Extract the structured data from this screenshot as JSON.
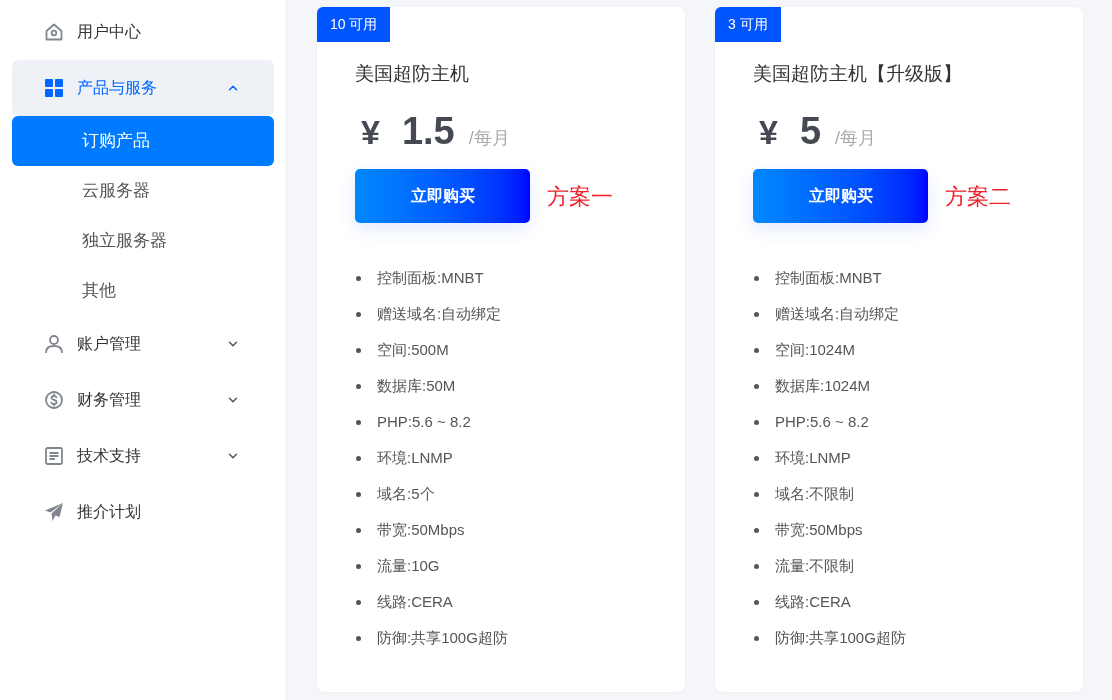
{
  "sidebar": {
    "items": [
      {
        "label": "用户中心",
        "kind": "link",
        "selected": false
      },
      {
        "label": "产品与服务",
        "kind": "group",
        "selected": true,
        "expanded": true,
        "children": [
          {
            "label": "订购产品",
            "selected": true
          },
          {
            "label": "云服务器",
            "selected": false
          },
          {
            "label": "独立服务器",
            "selected": false
          },
          {
            "label": "其他",
            "selected": false
          }
        ]
      },
      {
        "label": "账户管理",
        "kind": "group",
        "selected": false,
        "expanded": false
      },
      {
        "label": "财务管理",
        "kind": "group",
        "selected": false,
        "expanded": false
      },
      {
        "label": "技术支持",
        "kind": "group",
        "selected": false,
        "expanded": false
      },
      {
        "label": "推介计划",
        "kind": "link",
        "selected": false
      }
    ]
  },
  "plans": [
    {
      "badge": "10 可用",
      "name": "美国超防主机",
      "currency": "¥",
      "price": "1.5",
      "period": "/每月",
      "button": "立即购买",
      "note": "方案一",
      "features": [
        "控制面板:MNBT",
        "赠送域名:自动绑定",
        "空间:500M",
        "数据库:50M",
        "PHP:5.6 ~ 8.2",
        "环境:LNMP",
        "域名:5个",
        "带宽:50Mbps",
        "流量:10G",
        "线路:CERA",
        "防御:共享100G超防"
      ]
    },
    {
      "badge": "3 可用",
      "name": "美国超防主机【升级版】",
      "currency": "¥",
      "price": "5",
      "period": "/每月",
      "button": "立即购买",
      "note": "方案二",
      "features": [
        "控制面板:MNBT",
        "赠送域名:自动绑定",
        "空间:1024M",
        "数据库:1024M",
        "PHP:5.6 ~ 8.2",
        "环境:LNMP",
        "域名:不限制",
        "带宽:50Mbps",
        "流量:不限制",
        "线路:CERA",
        "防御:共享100G超防"
      ]
    }
  ]
}
